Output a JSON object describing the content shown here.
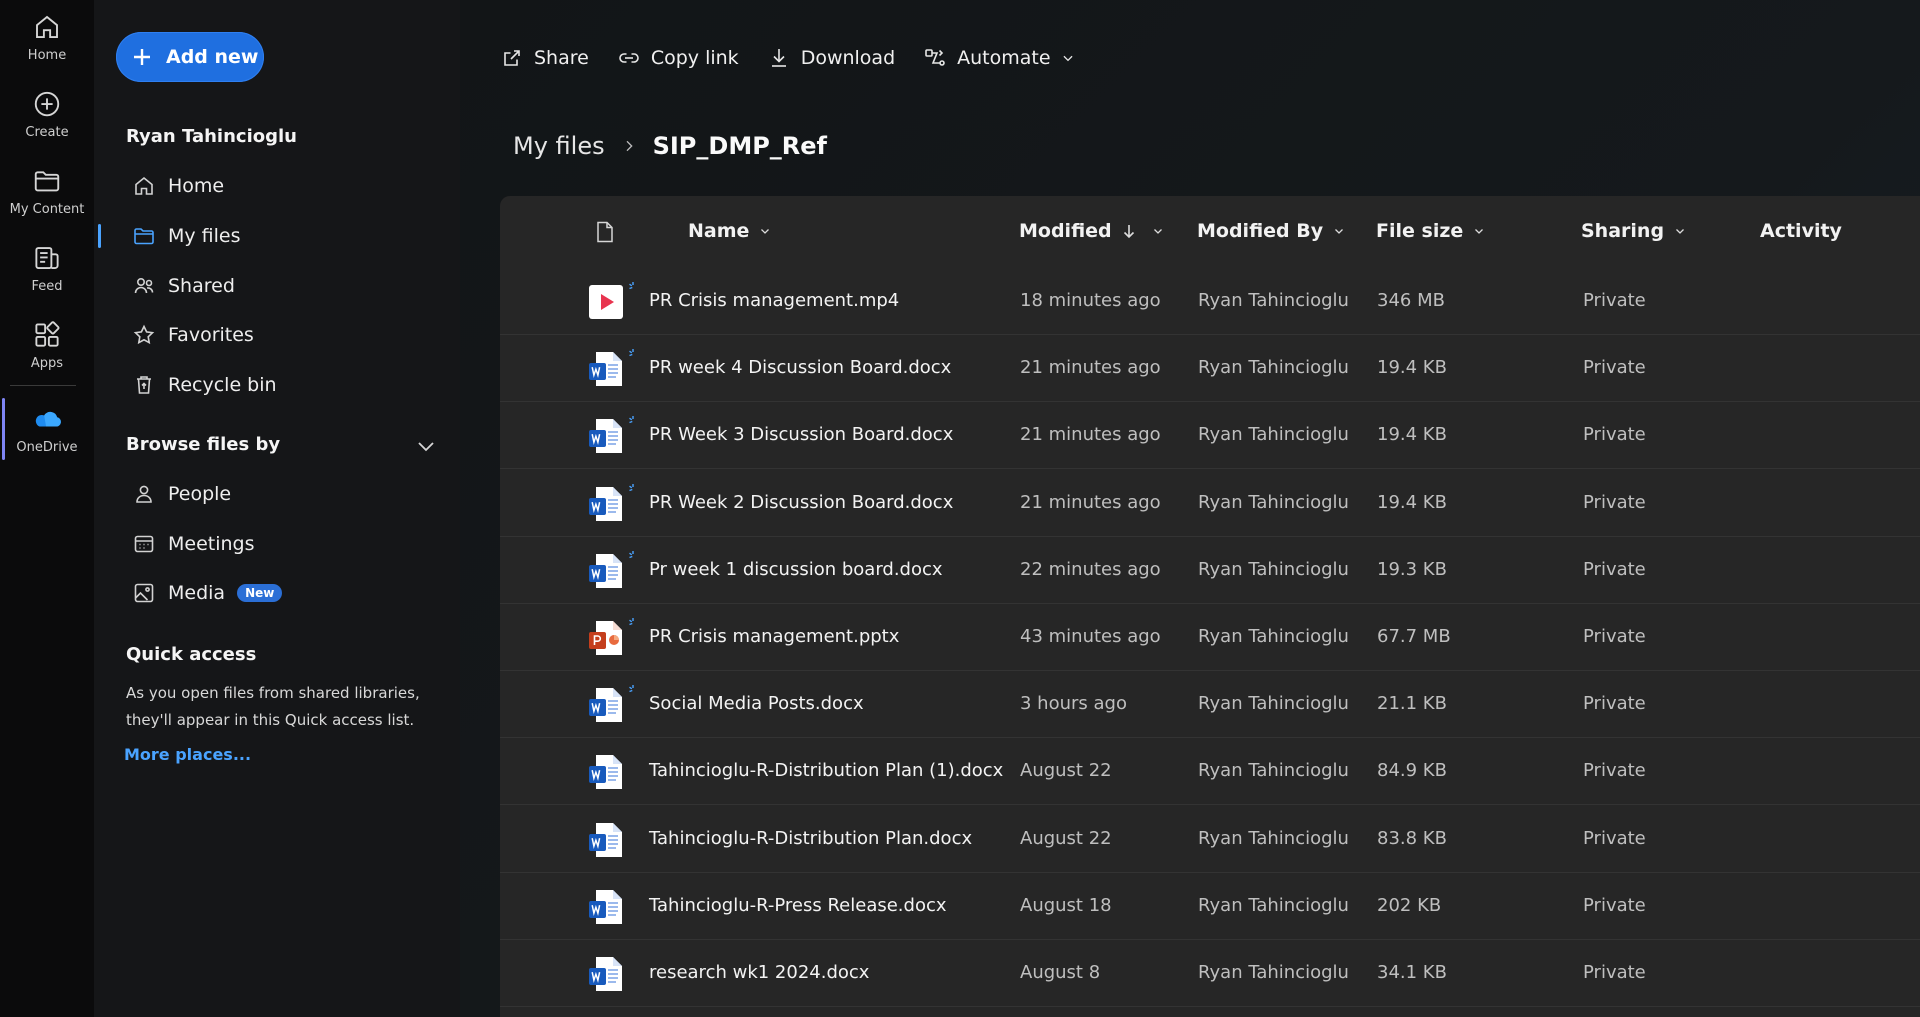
{
  "rail": {
    "items": [
      {
        "label": "Home",
        "icon": "home-icon"
      },
      {
        "label": "Create",
        "icon": "create-icon"
      },
      {
        "label": "My Content",
        "icon": "folder-icon"
      },
      {
        "label": "Feed",
        "icon": "feed-icon"
      },
      {
        "label": "Apps",
        "icon": "apps-icon"
      },
      {
        "label": "OneDrive",
        "icon": "onedrive-icon"
      }
    ]
  },
  "nav": {
    "add_new": "Add new",
    "user_name": "Ryan Tahincioglu",
    "items": [
      {
        "label": "Home",
        "icon": "home-icon"
      },
      {
        "label": "My files",
        "icon": "folder-icon"
      },
      {
        "label": "Shared",
        "icon": "people-icon"
      },
      {
        "label": "Favorites",
        "icon": "star-icon"
      },
      {
        "label": "Recycle bin",
        "icon": "recycle-bin-icon"
      }
    ],
    "browse_title": "Browse files by",
    "browse_items": [
      {
        "label": "People",
        "icon": "person-icon"
      },
      {
        "label": "Meetings",
        "icon": "calendar-icon"
      },
      {
        "label": "Media",
        "icon": "image-icon",
        "badge": "New"
      }
    ],
    "quick_access_title": "Quick access",
    "quick_access_desc": "As you open files from shared libraries, they'll appear in this Quick access list.",
    "more_places": "More places..."
  },
  "toolbar": {
    "share": "Share",
    "copy_link": "Copy link",
    "download": "Download",
    "automate": "Automate"
  },
  "breadcrumb": {
    "root": "My files",
    "current": "SIP_DMP_Ref"
  },
  "columns": {
    "name": "Name",
    "modified": "Modified",
    "modified_by": "Modified By",
    "file_size": "File size",
    "sharing": "Sharing",
    "activity": "Activity"
  },
  "colors": {
    "accent": "#4aa3ff",
    "add_new_bg": "#1f6fe0",
    "word": "#185abd",
    "powerpoint": "#c43e1c",
    "video": "#e8344f"
  },
  "files": [
    {
      "name": "PR Crisis management.mp4",
      "type": "video",
      "modified": "18 minutes ago",
      "modified_by": "Ryan Tahincioglu",
      "size": "346 MB",
      "sharing": "Private",
      "new": true
    },
    {
      "name": "PR week 4 Discussion Board.docx",
      "type": "word",
      "modified": "21 minutes ago",
      "modified_by": "Ryan Tahincioglu",
      "size": "19.4 KB",
      "sharing": "Private",
      "new": true
    },
    {
      "name": "PR Week 3 Discussion Board.docx",
      "type": "word",
      "modified": "21 minutes ago",
      "modified_by": "Ryan Tahincioglu",
      "size": "19.4 KB",
      "sharing": "Private",
      "new": true
    },
    {
      "name": "PR Week 2 Discussion Board.docx",
      "type": "word",
      "modified": "21 minutes ago",
      "modified_by": "Ryan Tahincioglu",
      "size": "19.4 KB",
      "sharing": "Private",
      "new": true
    },
    {
      "name": "Pr week 1 discussion board.docx",
      "type": "word",
      "modified": "22 minutes ago",
      "modified_by": "Ryan Tahincioglu",
      "size": "19.3 KB",
      "sharing": "Private",
      "new": true
    },
    {
      "name": "PR Crisis management.pptx",
      "type": "powerpoint",
      "modified": "43 minutes ago",
      "modified_by": "Ryan Tahincioglu",
      "size": "67.7 MB",
      "sharing": "Private",
      "new": true
    },
    {
      "name": "Social Media Posts.docx",
      "type": "word",
      "modified": "3 hours ago",
      "modified_by": "Ryan Tahincioglu",
      "size": "21.1 KB",
      "sharing": "Private",
      "new": true
    },
    {
      "name": "Tahincioglu-R-Distribution Plan (1).docx",
      "type": "word",
      "modified": "August 22",
      "modified_by": "Ryan Tahincioglu",
      "size": "84.9 KB",
      "sharing": "Private",
      "new": false
    },
    {
      "name": "Tahincioglu-R-Distribution Plan.docx",
      "type": "word",
      "modified": "August 22",
      "modified_by": "Ryan Tahincioglu",
      "size": "83.8 KB",
      "sharing": "Private",
      "new": false
    },
    {
      "name": "Tahincioglu-R-Press Release.docx",
      "type": "word",
      "modified": "August 18",
      "modified_by": "Ryan Tahincioglu",
      "size": "202 KB",
      "sharing": "Private",
      "new": false
    },
    {
      "name": "research wk1 2024.docx",
      "type": "word",
      "modified": "August 8",
      "modified_by": "Ryan Tahincioglu",
      "size": "34.1 KB",
      "sharing": "Private",
      "new": false
    }
  ]
}
